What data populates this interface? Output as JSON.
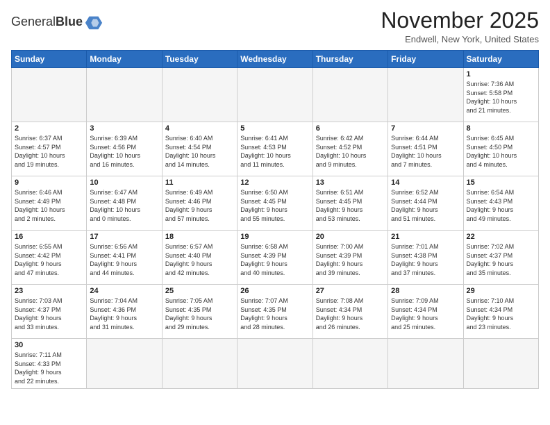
{
  "logo": {
    "text_normal": "General",
    "text_bold": "Blue"
  },
  "title": "November 2025",
  "location": "Endwell, New York, United States",
  "weekdays": [
    "Sunday",
    "Monday",
    "Tuesday",
    "Wednesday",
    "Thursday",
    "Friday",
    "Saturday"
  ],
  "weeks": [
    [
      {
        "day": "",
        "info": ""
      },
      {
        "day": "",
        "info": ""
      },
      {
        "day": "",
        "info": ""
      },
      {
        "day": "",
        "info": ""
      },
      {
        "day": "",
        "info": ""
      },
      {
        "day": "",
        "info": ""
      },
      {
        "day": "1",
        "info": "Sunrise: 7:36 AM\nSunset: 5:58 PM\nDaylight: 10 hours\nand 21 minutes."
      }
    ],
    [
      {
        "day": "2",
        "info": "Sunrise: 6:37 AM\nSunset: 4:57 PM\nDaylight: 10 hours\nand 19 minutes."
      },
      {
        "day": "3",
        "info": "Sunrise: 6:39 AM\nSunset: 4:56 PM\nDaylight: 10 hours\nand 16 minutes."
      },
      {
        "day": "4",
        "info": "Sunrise: 6:40 AM\nSunset: 4:54 PM\nDaylight: 10 hours\nand 14 minutes."
      },
      {
        "day": "5",
        "info": "Sunrise: 6:41 AM\nSunset: 4:53 PM\nDaylight: 10 hours\nand 11 minutes."
      },
      {
        "day": "6",
        "info": "Sunrise: 6:42 AM\nSunset: 4:52 PM\nDaylight: 10 hours\nand 9 minutes."
      },
      {
        "day": "7",
        "info": "Sunrise: 6:44 AM\nSunset: 4:51 PM\nDaylight: 10 hours\nand 7 minutes."
      },
      {
        "day": "8",
        "info": "Sunrise: 6:45 AM\nSunset: 4:50 PM\nDaylight: 10 hours\nand 4 minutes."
      }
    ],
    [
      {
        "day": "9",
        "info": "Sunrise: 6:46 AM\nSunset: 4:49 PM\nDaylight: 10 hours\nand 2 minutes."
      },
      {
        "day": "10",
        "info": "Sunrise: 6:47 AM\nSunset: 4:48 PM\nDaylight: 10 hours\nand 0 minutes."
      },
      {
        "day": "11",
        "info": "Sunrise: 6:49 AM\nSunset: 4:46 PM\nDaylight: 9 hours\nand 57 minutes."
      },
      {
        "day": "12",
        "info": "Sunrise: 6:50 AM\nSunset: 4:45 PM\nDaylight: 9 hours\nand 55 minutes."
      },
      {
        "day": "13",
        "info": "Sunrise: 6:51 AM\nSunset: 4:45 PM\nDaylight: 9 hours\nand 53 minutes."
      },
      {
        "day": "14",
        "info": "Sunrise: 6:52 AM\nSunset: 4:44 PM\nDaylight: 9 hours\nand 51 minutes."
      },
      {
        "day": "15",
        "info": "Sunrise: 6:54 AM\nSunset: 4:43 PM\nDaylight: 9 hours\nand 49 minutes."
      }
    ],
    [
      {
        "day": "16",
        "info": "Sunrise: 6:55 AM\nSunset: 4:42 PM\nDaylight: 9 hours\nand 47 minutes."
      },
      {
        "day": "17",
        "info": "Sunrise: 6:56 AM\nSunset: 4:41 PM\nDaylight: 9 hours\nand 44 minutes."
      },
      {
        "day": "18",
        "info": "Sunrise: 6:57 AM\nSunset: 4:40 PM\nDaylight: 9 hours\nand 42 minutes."
      },
      {
        "day": "19",
        "info": "Sunrise: 6:58 AM\nSunset: 4:39 PM\nDaylight: 9 hours\nand 40 minutes."
      },
      {
        "day": "20",
        "info": "Sunrise: 7:00 AM\nSunset: 4:39 PM\nDaylight: 9 hours\nand 39 minutes."
      },
      {
        "day": "21",
        "info": "Sunrise: 7:01 AM\nSunset: 4:38 PM\nDaylight: 9 hours\nand 37 minutes."
      },
      {
        "day": "22",
        "info": "Sunrise: 7:02 AM\nSunset: 4:37 PM\nDaylight: 9 hours\nand 35 minutes."
      }
    ],
    [
      {
        "day": "23",
        "info": "Sunrise: 7:03 AM\nSunset: 4:37 PM\nDaylight: 9 hours\nand 33 minutes."
      },
      {
        "day": "24",
        "info": "Sunrise: 7:04 AM\nSunset: 4:36 PM\nDaylight: 9 hours\nand 31 minutes."
      },
      {
        "day": "25",
        "info": "Sunrise: 7:05 AM\nSunset: 4:35 PM\nDaylight: 9 hours\nand 29 minutes."
      },
      {
        "day": "26",
        "info": "Sunrise: 7:07 AM\nSunset: 4:35 PM\nDaylight: 9 hours\nand 28 minutes."
      },
      {
        "day": "27",
        "info": "Sunrise: 7:08 AM\nSunset: 4:34 PM\nDaylight: 9 hours\nand 26 minutes."
      },
      {
        "day": "28",
        "info": "Sunrise: 7:09 AM\nSunset: 4:34 PM\nDaylight: 9 hours\nand 25 minutes."
      },
      {
        "day": "29",
        "info": "Sunrise: 7:10 AM\nSunset: 4:34 PM\nDaylight: 9 hours\nand 23 minutes."
      }
    ],
    [
      {
        "day": "30",
        "info": "Sunrise: 7:11 AM\nSunset: 4:33 PM\nDaylight: 9 hours\nand 22 minutes."
      },
      {
        "day": "",
        "info": ""
      },
      {
        "day": "",
        "info": ""
      },
      {
        "day": "",
        "info": ""
      },
      {
        "day": "",
        "info": ""
      },
      {
        "day": "",
        "info": ""
      },
      {
        "day": "",
        "info": ""
      }
    ]
  ]
}
